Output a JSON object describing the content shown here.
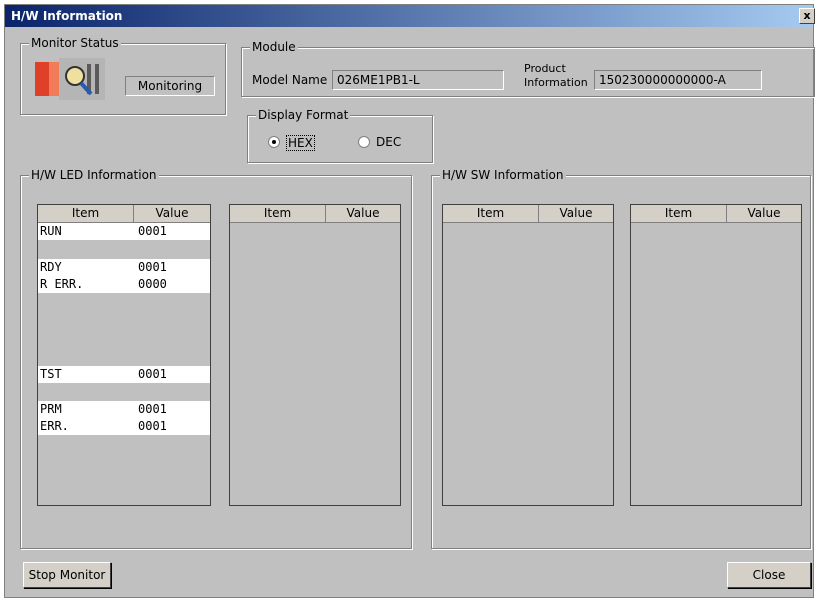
{
  "window": {
    "title": "H/W Information",
    "close_glyph": "x"
  },
  "monitor_status": {
    "legend": "Monitor Status",
    "status_text": "Monitoring",
    "icon": "monitoring-icon"
  },
  "module": {
    "legend": "Module",
    "model_name_label": "Model Name",
    "model_name_value": "026ME1PB1-L",
    "product_info_label_1": "Product",
    "product_info_label_2": "Information",
    "product_info_value": "150230000000000-A"
  },
  "display_format": {
    "legend": "Display Format",
    "hex_label": "HEX",
    "dec_label": "DEC",
    "selected": "HEX"
  },
  "hw_led": {
    "legend": "H/W LED Information",
    "table1": {
      "columns": [
        "Item",
        "Value"
      ],
      "rows": [
        {
          "item": "RUN",
          "value": "0001"
        },
        {
          "item": "RDY",
          "value": "0001"
        },
        {
          "item": "R ERR.",
          "value": "0000"
        },
        {
          "item": "TST",
          "value": "0001"
        },
        {
          "item": "PRM",
          "value": "0001"
        },
        {
          "item": "ERR.",
          "value": "0001"
        }
      ]
    },
    "table2": {
      "columns": [
        "Item",
        "Value"
      ]
    }
  },
  "hw_sw": {
    "legend": "H/W SW Information",
    "table1": {
      "columns": [
        "Item",
        "Value"
      ]
    },
    "table2": {
      "columns": [
        "Item",
        "Value"
      ]
    }
  },
  "buttons": {
    "stop_monitor": "Stop Monitor",
    "close": "Close"
  }
}
